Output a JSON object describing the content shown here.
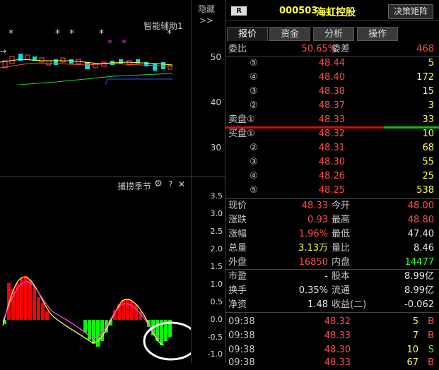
{
  "header": {
    "badge": "R",
    "code": "000503",
    "name": "海虹控股",
    "matrix_button": "决策矩阵",
    "hide_button": "隐藏>>"
  },
  "tabs": [
    "报价",
    "资金",
    "分析",
    "操作"
  ],
  "indicators": {
    "assist": "智能辅助1",
    "catch_title": "捕捞季节",
    "gear_icon": "gear-icon",
    "help_icon": "help-icon",
    "close_icon": "close-icon"
  },
  "price_axis": [
    "50",
    "40",
    "30"
  ],
  "osc_axis": [
    "3.5",
    "3.0",
    "2.5",
    "2.0",
    "1.5",
    "1.0",
    "0.5",
    "0.0",
    "-0.5",
    "-1.0"
  ],
  "stars_white": [
    "*",
    "*",
    "*",
    "*",
    "*"
  ],
  "stars_purple": [
    "*",
    "*"
  ],
  "quote": {
    "weibi_label": "委比",
    "weibi_val": "50.65%",
    "weicha_label": "委差",
    "weicha_val": "468",
    "sell": [
      {
        "label": "⑤",
        "price": "48.44",
        "vol": "5"
      },
      {
        "label": "④",
        "price": "48.40",
        "vol": "172"
      },
      {
        "label": "③",
        "price": "48.38",
        "vol": "15"
      },
      {
        "label": "②",
        "price": "48.37",
        "vol": "3"
      },
      {
        "label": "卖盘①",
        "price": "48.33",
        "vol": "33"
      }
    ],
    "buy": [
      {
        "label": "买盘①",
        "price": "48.32",
        "vol": "10"
      },
      {
        "label": "②",
        "price": "48.31",
        "vol": "68"
      },
      {
        "label": "③",
        "price": "48.30",
        "vol": "55"
      },
      {
        "label": "④",
        "price": "48.26",
        "vol": "25"
      },
      {
        "label": "⑤",
        "price": "48.25",
        "vol": "538"
      }
    ],
    "stats": [
      {
        "l1": "现价",
        "v1": "48.33",
        "c1": "red",
        "l2": "今开",
        "v2": "48.00",
        "c2": "red"
      },
      {
        "l1": "涨跌",
        "v1": "0.93",
        "c1": "red",
        "l2": "最高",
        "v2": "48.80",
        "c2": "red"
      },
      {
        "l1": "涨幅",
        "v1": "1.96%",
        "c1": "red",
        "l2": "最低",
        "v2": "47.40",
        "c2": "wht"
      },
      {
        "l1": "总量",
        "v1": "3.13万",
        "c1": "yel",
        "l2": "量比",
        "v2": "8.46",
        "c2": "wht"
      },
      {
        "l1": "外盘",
        "v1": "16850",
        "c1": "red",
        "l2": "内盘",
        "v2": "14477",
        "c2": "grn"
      }
    ],
    "fund": [
      {
        "l1": "市盈",
        "v1": "-",
        "l2": "股本",
        "v2": "8.99亿"
      },
      {
        "l1": "换手",
        "v1": "0.35%",
        "l2": "流通",
        "v2": "8.99亿"
      },
      {
        "l1": "净资",
        "v1": "1.48",
        "l2": "收益(二)",
        "v2": "-0.062"
      }
    ],
    "ticks": [
      {
        "time": "09:38",
        "price": "48.32",
        "vol": "5",
        "dir": "B"
      },
      {
        "time": "09:38",
        "price": "48.33",
        "vol": "7",
        "dir": "B"
      },
      {
        "time": "09:38",
        "price": "48.30",
        "vol": "10",
        "dir": "S"
      },
      {
        "time": "09:38",
        "price": "48.33",
        "vol": "67",
        "dir": "B"
      }
    ]
  },
  "colors": {
    "up": "#ff4b4b",
    "down": "#3cff3c",
    "accent": "#ffff3c",
    "purple": "#d040d0"
  }
}
